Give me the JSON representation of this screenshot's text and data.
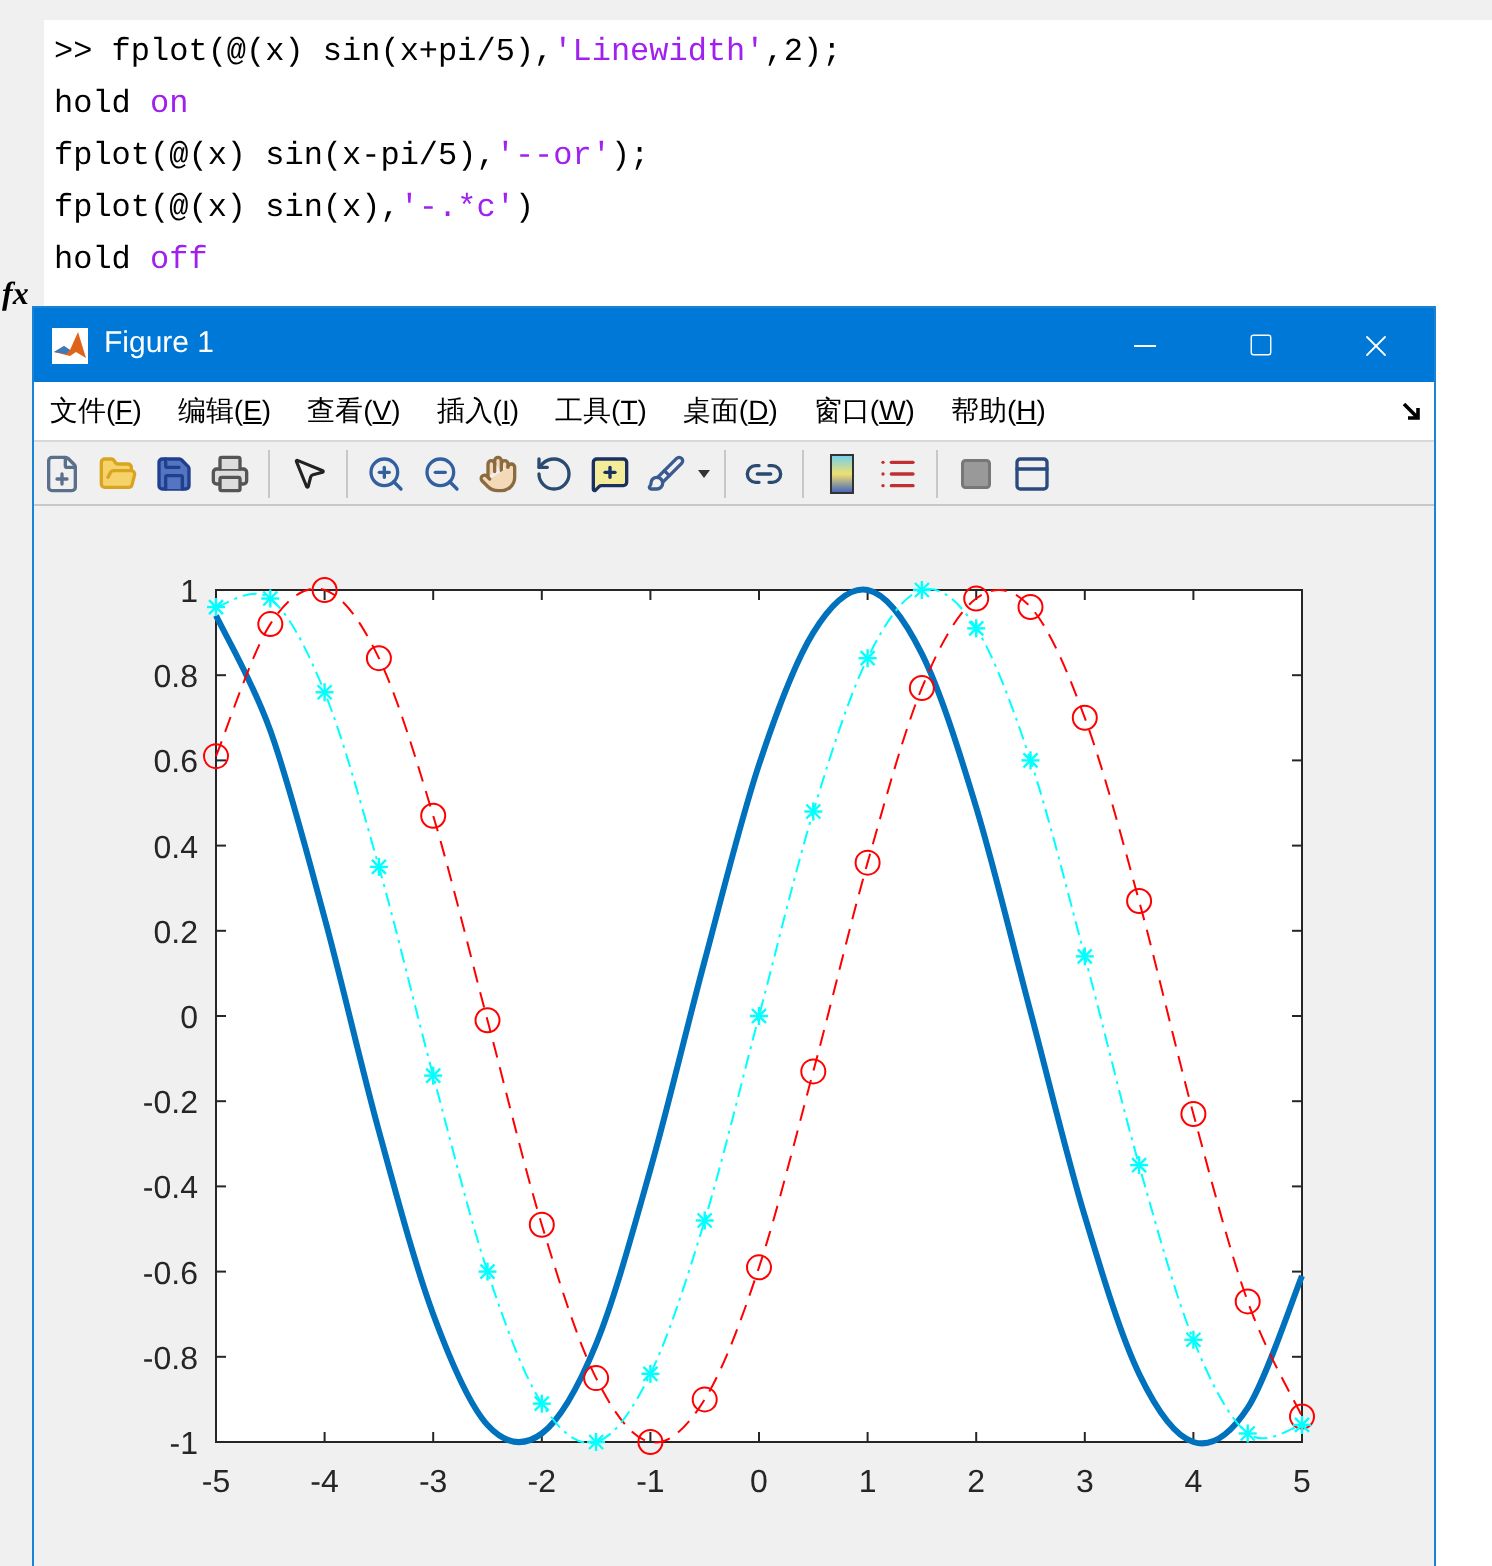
{
  "command_window": {
    "lines": [
      {
        "parts": [
          {
            "kind": "code",
            "text": ">> fplot(@(x) sin(x+pi/5),"
          },
          {
            "kind": "string",
            "text": "'Linewidth'"
          },
          {
            "kind": "code",
            "text": ",2);"
          }
        ]
      },
      {
        "parts": [
          {
            "kind": "code",
            "text": "hold "
          },
          {
            "kind": "string",
            "text": "on"
          }
        ]
      },
      {
        "parts": [
          {
            "kind": "code",
            "text": "fplot(@(x) sin(x-pi/5),"
          },
          {
            "kind": "string",
            "text": "'--or'"
          },
          {
            "kind": "code",
            "text": ");"
          }
        ]
      },
      {
        "parts": [
          {
            "kind": "code",
            "text": "fplot(@(x) sin(x),"
          },
          {
            "kind": "string",
            "text": "'-.*c'"
          },
          {
            "kind": "code",
            "text": ")"
          }
        ]
      },
      {
        "parts": [
          {
            "kind": "code",
            "text": "hold "
          },
          {
            "kind": "string",
            "text": "off"
          }
        ]
      }
    ],
    "prompt_icon": "fx"
  },
  "figure_window": {
    "title": "Figure 1",
    "menu": [
      {
        "label": "文件(F)"
      },
      {
        "label": "编辑(E)"
      },
      {
        "label": "查看(V)"
      },
      {
        "label": "插入(I)"
      },
      {
        "label": "工具(T)"
      },
      {
        "label": "桌面(D)"
      },
      {
        "label": "窗口(W)"
      },
      {
        "label": "帮助(H)"
      }
    ],
    "chart_data": {
      "type": "line",
      "xlim": [
        -5,
        5
      ],
      "ylim": [
        -1,
        1
      ],
      "xticks": [
        -5,
        -4,
        -3,
        -2,
        -1,
        0,
        1,
        2,
        3,
        4,
        5
      ],
      "yticks": [
        -1,
        -0.8,
        -0.6,
        -0.4,
        -0.2,
        0,
        0.2,
        0.4,
        0.6,
        0.8,
        1
      ],
      "x": [
        -5,
        -4.5,
        -4,
        -3.5,
        -3,
        -2.5,
        -2,
        -1.5,
        -1,
        -0.5,
        0,
        0.5,
        1,
        1.5,
        2,
        2.5,
        3,
        3.5,
        4,
        4.5,
        5
      ],
      "series": [
        {
          "color": "#0072bd",
          "line_style": "solid",
          "marker": "none",
          "values": [
            0.94,
            0.67,
            0.23,
            -0.27,
            -0.7,
            -0.96,
            -0.98,
            -0.77,
            -0.36,
            0.13,
            0.59,
            0.9,
            1,
            0.85,
            0.49,
            0.01,
            -0.47,
            -0.84,
            -1,
            -0.92,
            -0.61
          ]
        },
        {
          "color": "#ff0000",
          "line_style": "dashed",
          "marker": "circle",
          "values": [
            0.61,
            0.92,
            1,
            0.84,
            0.47,
            -0.01,
            -0.49,
            -0.85,
            -1,
            -0.9,
            -0.59,
            -0.13,
            0.36,
            0.77,
            0.98,
            0.96,
            0.7,
            0.27,
            -0.23,
            -0.67,
            -0.94
          ]
        },
        {
          "color": "#00ffff",
          "line_style": "dashdot",
          "marker": "cross",
          "values": [
            0.96,
            0.98,
            0.76,
            0.35,
            -0.14,
            -0.6,
            -0.91,
            -1,
            -0.84,
            -0.48,
            0,
            0.48,
            0.84,
            1,
            0.91,
            0.6,
            0.14,
            -0.35,
            -0.76,
            -0.98,
            -0.96
          ]
        }
      ]
    }
  }
}
